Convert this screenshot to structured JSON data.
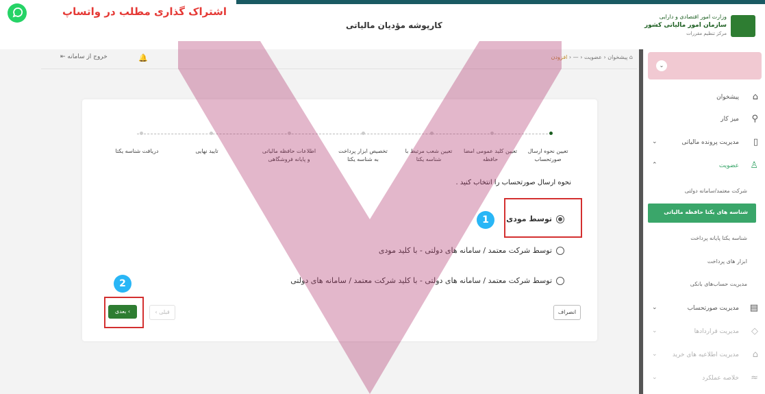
{
  "header": {
    "app_title": "کارپوشه مؤدیان مالیاتی"
  },
  "logo": {
    "line1": "وزارت امور اقتصادی و دارایی",
    "line2": "سازمان امور مالیاتی کشور",
    "line3": "مرکز تنظیم مقررات"
  },
  "share_banner": {
    "text": "اشتراک گذاری مطلب در واتساپ"
  },
  "topnav": {
    "logout": "خروج از سامانه",
    "breadcrumb": [
      "پیشخوان",
      "عضویت",
      "—",
      "افزودن"
    ]
  },
  "sidebar": {
    "items": [
      {
        "label": "پیشخوان",
        "icon": "home-icon"
      },
      {
        "label": "میز کار",
        "icon": "workspace-icon"
      },
      {
        "label": "مدیریت پرونده مالیاتی",
        "icon": "file-icon"
      },
      {
        "label": "عضویت",
        "icon": "user-icon"
      }
    ],
    "subitems": [
      "شرکت معتمد/سامانه دولتی",
      "شناسه های یکتا حافظه مالیاتی",
      "شناسه یکتا پایانه پرداخت",
      "ابزار های پرداخت",
      "مدیریت حساب‌های بانکی"
    ],
    "bottom_items": [
      {
        "label": "مدیریت صورتحساب",
        "icon": "invoice-icon"
      },
      {
        "label": "مدیریت قراردادها",
        "icon": "contract-icon"
      },
      {
        "label": "مدیریت اطلاعیه های خرید",
        "icon": "bag-icon"
      },
      {
        "label": "خلاصه عملکرد",
        "icon": "chart-icon"
      }
    ]
  },
  "wizard": {
    "steps": [
      "تعیین نحوه ارسال صورتحساب",
      "تعیین کلید عمومی امضا حافظه",
      "تعیین شعب مرتبط با شناسه یکتا",
      "تخصیص ابزار پرداخت به شناسه یکتا",
      "اطلاعات حافظه مالیاتی و پایانه فروشگاهی",
      "تایید نهایی",
      "دریافت شناسه یکتا"
    ],
    "question": "نحوه ارسال صورتحساب را انتخاب کنید .",
    "options": [
      "توسط مودی",
      "توسط شرکت معتمد / سامانه های دولتی - با کلید مودی",
      "توسط شرکت معتمد / سامانه های دولتی - با کلید شرکت معتمد / سامانه های دولتی"
    ],
    "selected_option": 0,
    "buttons": {
      "next": "بعدی  ‹",
      "prev": "‹  قبلی",
      "cancel": "انصراف"
    }
  },
  "annotations": {
    "badge1": "1",
    "badge2": "2"
  },
  "colors": {
    "accent_green": "#2e7d32",
    "active_sidebar": "#3aa66a",
    "highlight_red": "#d32f2f",
    "badge_blue": "#29b6f6",
    "watermark_pink": "#b0306b"
  }
}
